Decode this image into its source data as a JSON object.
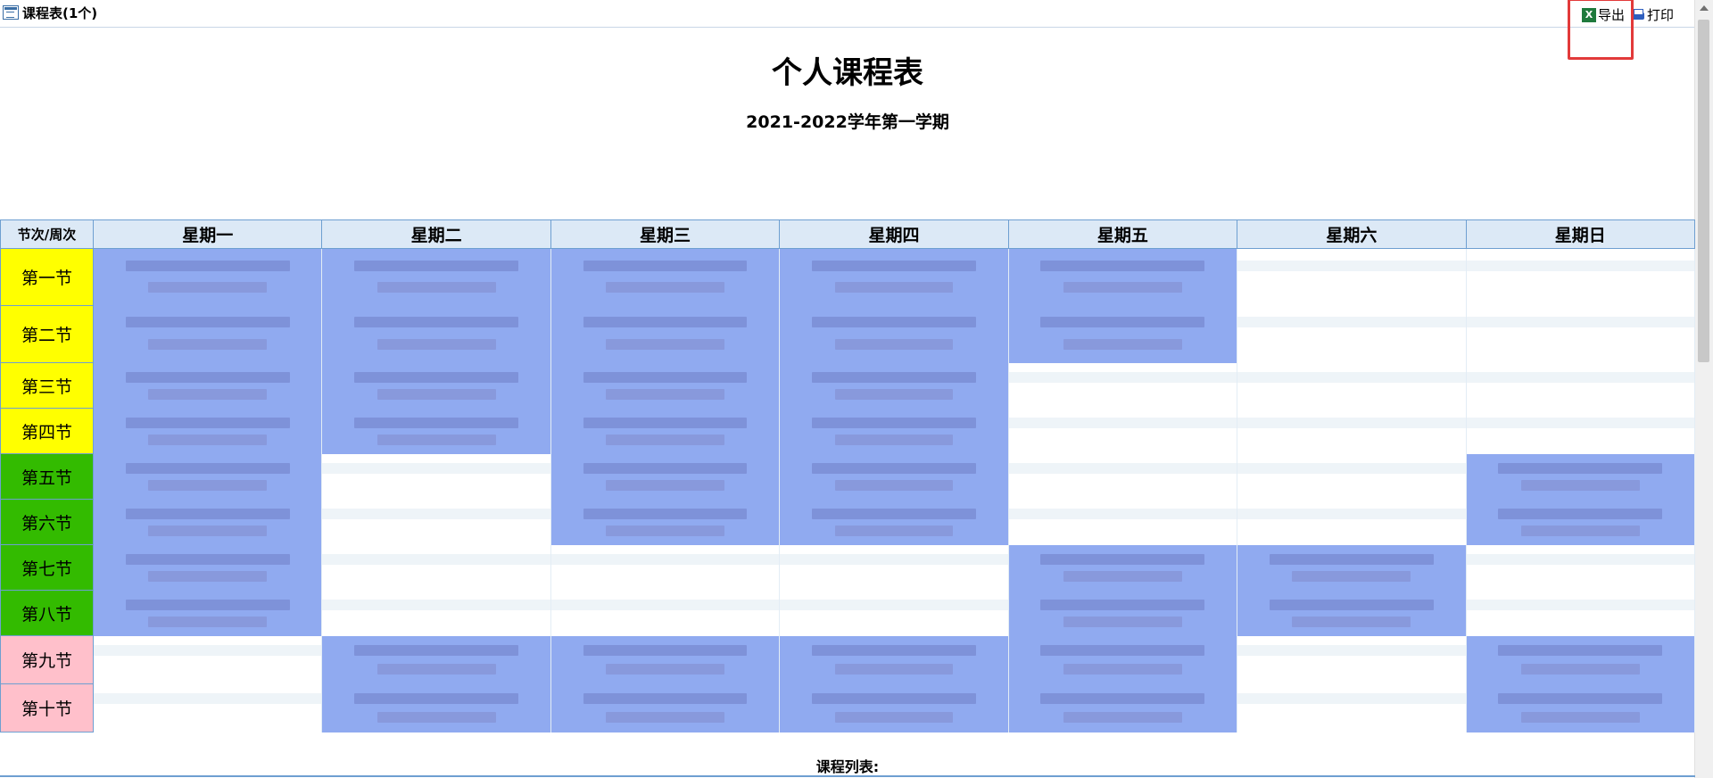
{
  "window": {
    "title": "课程表(1个)"
  },
  "toolbar": {
    "export_label": "导出",
    "print_label": "打印"
  },
  "page": {
    "title": "个人课程表",
    "term": "2021-2022学年第一学期",
    "list_label": "课程列表:"
  },
  "schedule": {
    "corner_label": "节次/周次",
    "days": [
      "星期一",
      "星期二",
      "星期三",
      "星期四",
      "星期五",
      "星期六",
      "星期日"
    ],
    "periods": [
      "第一节",
      "第二节",
      "第三节",
      "第四节",
      "第五节",
      "第六节",
      "第七节",
      "第八节",
      "第九节",
      "第十节"
    ],
    "period_colors": [
      "#ffff00",
      "#ffff00",
      "#ffff00",
      "#ffff00",
      "#33bb00",
      "#33bb00",
      "#33bb00",
      "#33bb00",
      "#ffc0cb",
      "#ffc0cb"
    ],
    "course_color": "#90aaf0",
    "grid": [
      [
        1,
        1,
        1,
        1,
        1,
        0,
        0
      ],
      [
        1,
        1,
        1,
        1,
        1,
        0,
        0
      ],
      [
        1,
        1,
        1,
        1,
        0,
        0,
        0
      ],
      [
        1,
        1,
        1,
        1,
        0,
        0,
        0
      ],
      [
        1,
        0,
        1,
        1,
        0,
        0,
        1
      ],
      [
        1,
        0,
        1,
        1,
        0,
        0,
        1
      ],
      [
        1,
        0,
        0,
        0,
        1,
        1,
        0
      ],
      [
        1,
        0,
        0,
        0,
        1,
        1,
        0
      ],
      [
        0,
        1,
        1,
        1,
        1,
        0,
        1
      ],
      [
        0,
        1,
        1,
        1,
        1,
        0,
        1
      ]
    ]
  }
}
